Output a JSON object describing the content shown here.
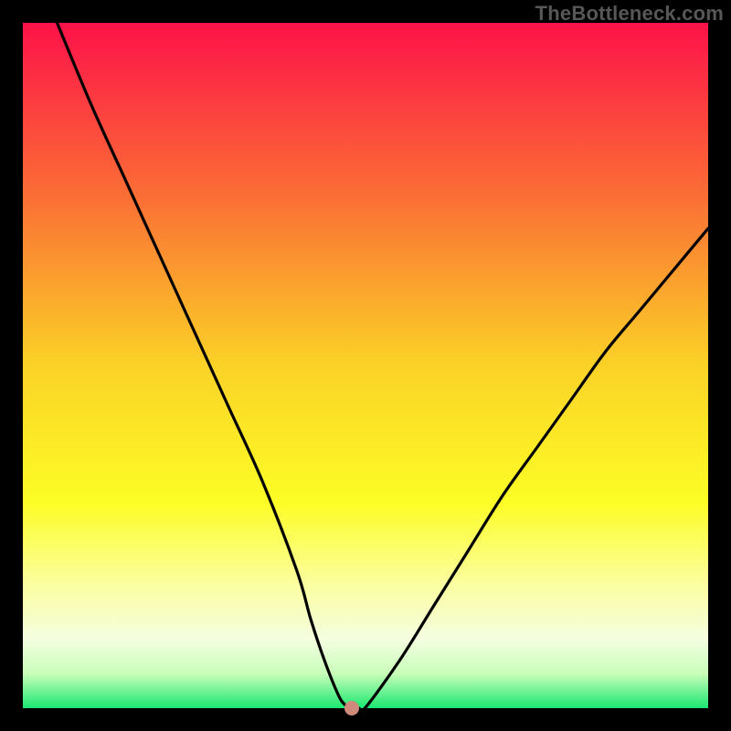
{
  "watermark": "TheBottleneck.com",
  "chart_data": {
    "type": "line",
    "title": "",
    "xlabel": "",
    "ylabel": "",
    "xlim": [
      0,
      100
    ],
    "ylim": [
      0,
      100
    ],
    "grid": false,
    "legend": false,
    "series": [
      {
        "name": "bottleneck-curve",
        "x": [
          5,
          10,
          15,
          20,
          25,
          30,
          35,
          40,
          42,
          44,
          46,
          47,
          48,
          49,
          50,
          55,
          60,
          65,
          70,
          75,
          80,
          85,
          90,
          95,
          100
        ],
        "y": [
          100,
          88,
          77,
          66,
          55,
          44,
          33,
          20,
          13,
          7,
          2,
          0.5,
          0,
          0,
          0.1,
          7,
          15,
          23,
          31,
          38,
          45,
          52,
          58,
          64,
          70
        ]
      }
    ],
    "marker": {
      "x": 48,
      "y": 0,
      "name": "bottleneck-point"
    },
    "background_gradient": {
      "type": "vertical",
      "stops": [
        {
          "pos": 0.0,
          "color": "#fd1249"
        },
        {
          "pos": 0.25,
          "color": "#fb6d35"
        },
        {
          "pos": 0.5,
          "color": "#fbd227"
        },
        {
          "pos": 0.7,
          "color": "#fcfd26"
        },
        {
          "pos": 0.82,
          "color": "#fbfea0"
        },
        {
          "pos": 0.9,
          "color": "#f4fee1"
        },
        {
          "pos": 0.95,
          "color": "#c8feb8"
        },
        {
          "pos": 1.0,
          "color": "#1ae870"
        }
      ]
    }
  }
}
